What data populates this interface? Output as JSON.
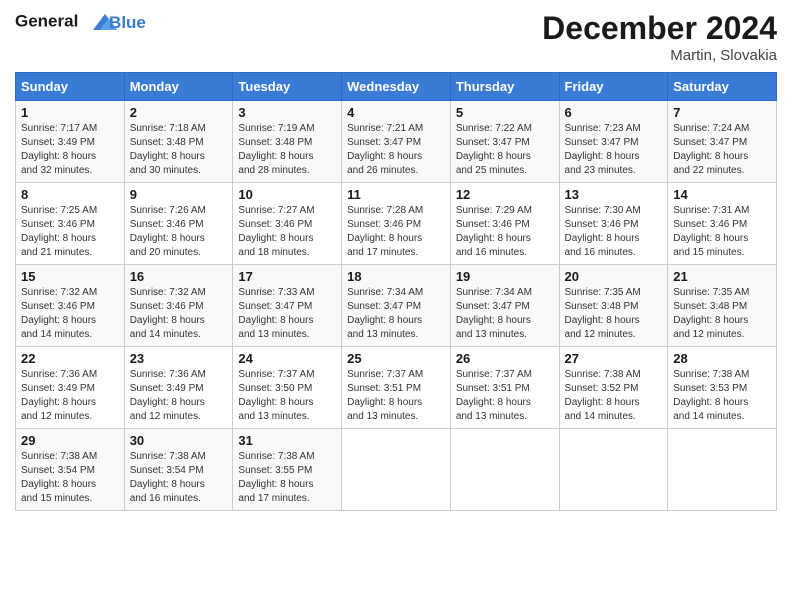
{
  "header": {
    "logo_line1": "General",
    "logo_line2": "Blue",
    "month_year": "December 2024",
    "location": "Martin, Slovakia"
  },
  "days_of_week": [
    "Sunday",
    "Monday",
    "Tuesday",
    "Wednesday",
    "Thursday",
    "Friday",
    "Saturday"
  ],
  "weeks": [
    [
      {
        "day": "1",
        "info": "Sunrise: 7:17 AM\nSunset: 3:49 PM\nDaylight: 8 hours\nand 32 minutes."
      },
      {
        "day": "2",
        "info": "Sunrise: 7:18 AM\nSunset: 3:48 PM\nDaylight: 8 hours\nand 30 minutes."
      },
      {
        "day": "3",
        "info": "Sunrise: 7:19 AM\nSunset: 3:48 PM\nDaylight: 8 hours\nand 28 minutes."
      },
      {
        "day": "4",
        "info": "Sunrise: 7:21 AM\nSunset: 3:47 PM\nDaylight: 8 hours\nand 26 minutes."
      },
      {
        "day": "5",
        "info": "Sunrise: 7:22 AM\nSunset: 3:47 PM\nDaylight: 8 hours\nand 25 minutes."
      },
      {
        "day": "6",
        "info": "Sunrise: 7:23 AM\nSunset: 3:47 PM\nDaylight: 8 hours\nand 23 minutes."
      },
      {
        "day": "7",
        "info": "Sunrise: 7:24 AM\nSunset: 3:47 PM\nDaylight: 8 hours\nand 22 minutes."
      }
    ],
    [
      {
        "day": "8",
        "info": "Sunrise: 7:25 AM\nSunset: 3:46 PM\nDaylight: 8 hours\nand 21 minutes."
      },
      {
        "day": "9",
        "info": "Sunrise: 7:26 AM\nSunset: 3:46 PM\nDaylight: 8 hours\nand 20 minutes."
      },
      {
        "day": "10",
        "info": "Sunrise: 7:27 AM\nSunset: 3:46 PM\nDaylight: 8 hours\nand 18 minutes."
      },
      {
        "day": "11",
        "info": "Sunrise: 7:28 AM\nSunset: 3:46 PM\nDaylight: 8 hours\nand 17 minutes."
      },
      {
        "day": "12",
        "info": "Sunrise: 7:29 AM\nSunset: 3:46 PM\nDaylight: 8 hours\nand 16 minutes."
      },
      {
        "day": "13",
        "info": "Sunrise: 7:30 AM\nSunset: 3:46 PM\nDaylight: 8 hours\nand 16 minutes."
      },
      {
        "day": "14",
        "info": "Sunrise: 7:31 AM\nSunset: 3:46 PM\nDaylight: 8 hours\nand 15 minutes."
      }
    ],
    [
      {
        "day": "15",
        "info": "Sunrise: 7:32 AM\nSunset: 3:46 PM\nDaylight: 8 hours\nand 14 minutes."
      },
      {
        "day": "16",
        "info": "Sunrise: 7:32 AM\nSunset: 3:46 PM\nDaylight: 8 hours\nand 14 minutes."
      },
      {
        "day": "17",
        "info": "Sunrise: 7:33 AM\nSunset: 3:47 PM\nDaylight: 8 hours\nand 13 minutes."
      },
      {
        "day": "18",
        "info": "Sunrise: 7:34 AM\nSunset: 3:47 PM\nDaylight: 8 hours\nand 13 minutes."
      },
      {
        "day": "19",
        "info": "Sunrise: 7:34 AM\nSunset: 3:47 PM\nDaylight: 8 hours\nand 13 minutes."
      },
      {
        "day": "20",
        "info": "Sunrise: 7:35 AM\nSunset: 3:48 PM\nDaylight: 8 hours\nand 12 minutes."
      },
      {
        "day": "21",
        "info": "Sunrise: 7:35 AM\nSunset: 3:48 PM\nDaylight: 8 hours\nand 12 minutes."
      }
    ],
    [
      {
        "day": "22",
        "info": "Sunrise: 7:36 AM\nSunset: 3:49 PM\nDaylight: 8 hours\nand 12 minutes."
      },
      {
        "day": "23",
        "info": "Sunrise: 7:36 AM\nSunset: 3:49 PM\nDaylight: 8 hours\nand 12 minutes."
      },
      {
        "day": "24",
        "info": "Sunrise: 7:37 AM\nSunset: 3:50 PM\nDaylight: 8 hours\nand 13 minutes."
      },
      {
        "day": "25",
        "info": "Sunrise: 7:37 AM\nSunset: 3:51 PM\nDaylight: 8 hours\nand 13 minutes."
      },
      {
        "day": "26",
        "info": "Sunrise: 7:37 AM\nSunset: 3:51 PM\nDaylight: 8 hours\nand 13 minutes."
      },
      {
        "day": "27",
        "info": "Sunrise: 7:38 AM\nSunset: 3:52 PM\nDaylight: 8 hours\nand 14 minutes."
      },
      {
        "day": "28",
        "info": "Sunrise: 7:38 AM\nSunset: 3:53 PM\nDaylight: 8 hours\nand 14 minutes."
      }
    ],
    [
      {
        "day": "29",
        "info": "Sunrise: 7:38 AM\nSunset: 3:54 PM\nDaylight: 8 hours\nand 15 minutes."
      },
      {
        "day": "30",
        "info": "Sunrise: 7:38 AM\nSunset: 3:54 PM\nDaylight: 8 hours\nand 16 minutes."
      },
      {
        "day": "31",
        "info": "Sunrise: 7:38 AM\nSunset: 3:55 PM\nDaylight: 8 hours\nand 17 minutes."
      },
      {
        "day": "",
        "info": ""
      },
      {
        "day": "",
        "info": ""
      },
      {
        "day": "",
        "info": ""
      },
      {
        "day": "",
        "info": ""
      }
    ]
  ]
}
